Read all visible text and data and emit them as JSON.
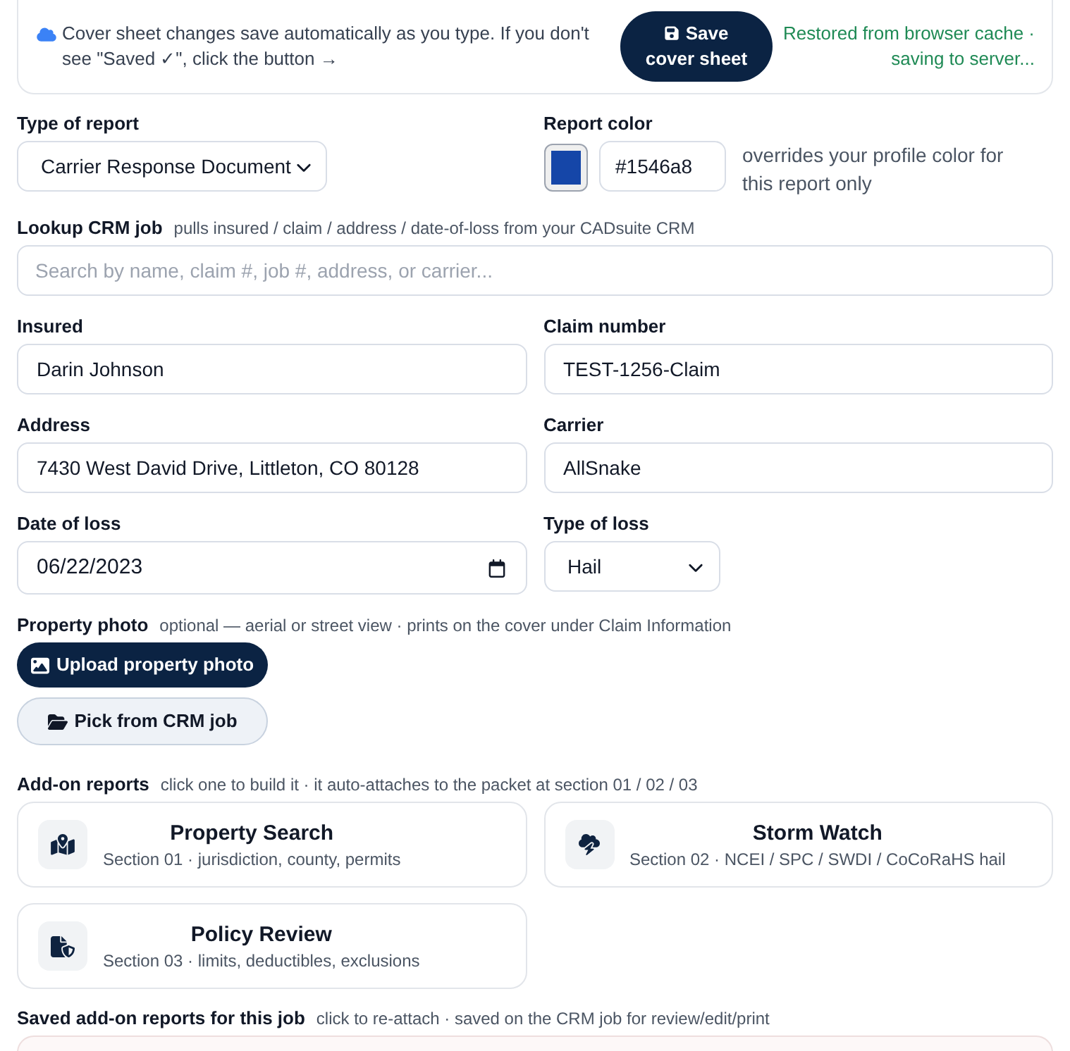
{
  "banner": {
    "message": "Cover sheet changes save automatically as you type. If you don't see \"Saved ✓\", click the button →",
    "save_button": "Save cover sheet",
    "status": "Restored from browser cache · saving to server..."
  },
  "report_type": {
    "label": "Type of report",
    "value": "Carrier Response Document"
  },
  "report_color": {
    "label": "Report color",
    "value": "#1546a8",
    "note": "overrides your profile color for this report only"
  },
  "crm_lookup": {
    "label": "Lookup CRM job",
    "hint": "pulls insured / claim / address / date-of-loss from your CADsuite CRM",
    "placeholder": "Search by name, claim #, job #, address, or carrier..."
  },
  "fields": [
    {
      "label": "Insured",
      "value": "Darin Johnson",
      "kind": "text"
    },
    {
      "label": "Claim number",
      "value": "TEST-1256-Claim",
      "kind": "text"
    },
    {
      "label": "Address",
      "value": "7430 West David Drive, Littleton, CO 80128",
      "kind": "text"
    },
    {
      "label": "Carrier",
      "value": "AllSnake",
      "kind": "text"
    },
    {
      "label": "Date of loss",
      "value": "06/22/2023",
      "kind": "date"
    },
    {
      "label": "Type of loss",
      "value": "Hail",
      "kind": "select"
    }
  ],
  "property_photo": {
    "label": "Property photo",
    "hint": "optional — aerial or street view · prints on the cover under Claim Information",
    "buttons": [
      {
        "label": "Upload property photo",
        "kind": "upload"
      },
      {
        "label": "Pick from CRM job",
        "kind": "pick"
      }
    ]
  },
  "add_on_reports": {
    "label": "Add-on reports",
    "hint": "click one to build it · it auto-attaches to the packet at section 01 / 02 / 03",
    "cards": [
      {
        "title": "Property Search",
        "subtitle": "Section 01 · jurisdiction, county, permits",
        "kind": "property"
      },
      {
        "title": "Storm Watch",
        "subtitle": "Section 02 · NCEI / SPC / SWDI / CoCoRaHS hail",
        "kind": "storm"
      },
      {
        "title": "Policy Review",
        "subtitle": "Section 03 · limits, deductibles, exclusions",
        "kind": "policy"
      }
    ]
  },
  "saved_reports": {
    "label": "Saved add-on reports for this job",
    "hint": "click to re-attach · saved on the CRM job for review/edit/print"
  }
}
